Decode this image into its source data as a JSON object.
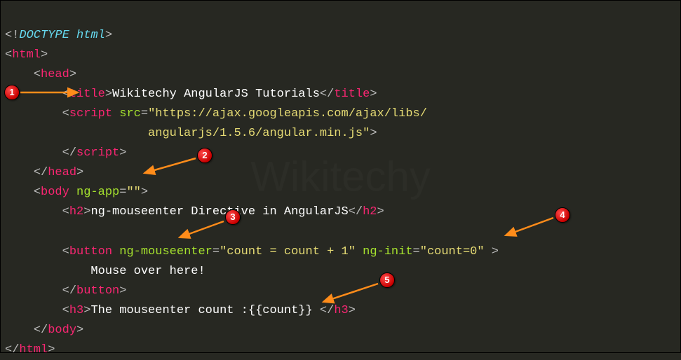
{
  "watermark": "Wikitechy",
  "doctype_kw": "DOCTYPE html",
  "tags": {
    "html": "html",
    "head": "head",
    "title": "title",
    "script": "script",
    "body": "body",
    "h2": "h2",
    "button": "button",
    "h3": "h3"
  },
  "attrs": {
    "src": "src",
    "ng_app": "ng-app",
    "ng_mouseenter": "ng-mouseenter",
    "ng_init": "ng-init"
  },
  "values": {
    "src_line1": "\"https://ajax.googleapis.com/ajax/libs/",
    "src_line2": "angularjs/1.5.6/angular.min.js\"",
    "ng_app_val": "\"\"",
    "ng_mouseenter_val": "\"count = count + 1\"",
    "ng_init_val": "\"count=0\""
  },
  "text": {
    "title_text": "Wikitechy AngularJS Tutorials",
    "h2_text": "ng-mouseenter Directive in AngularJS",
    "button_text": "Mouse over here!",
    "h3_prefix": "The mouseenter count :",
    "h3_expr": "{{count}}"
  },
  "markers": {
    "m1": "1",
    "m2": "2",
    "m3": "3",
    "m4": "4",
    "m5": "5"
  }
}
